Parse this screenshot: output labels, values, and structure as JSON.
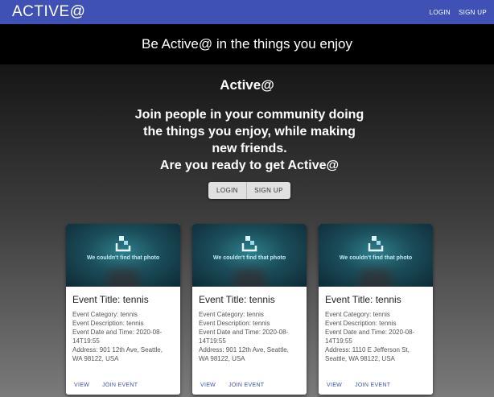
{
  "appbar": {
    "brand": "ACTIVE@",
    "login_label": "LOGIN",
    "signup_label": "SIGN UP",
    "color": "#3f51b5"
  },
  "banner": {
    "text": "Be Active@ in the things you enjoy"
  },
  "hero": {
    "title": "Active@",
    "lines": [
      "Join people in your community doing",
      "the things you enjoy, while making",
      "new friends.",
      "Are you ready to get Active@"
    ],
    "login_label": "LOGIN",
    "signup_label": "SIGN UP"
  },
  "cards": [
    {
      "image_text": "We couldn't find that photo",
      "title": "Event Title: tennis",
      "category": "Event Category: tennis",
      "description": "Event Description: tennis",
      "datetime_a": "Event Date and Time: 2020-08-",
      "datetime_b": "14T19:55",
      "address_a": "Address: 901 12th Ave, Seattle,",
      "address_b": "WA 98122, USA",
      "view_label": "VIEW",
      "join_label": "JOIN EVENT"
    },
    {
      "image_text": "We couldn't find that photo",
      "title": "Event Title: tennis",
      "category": "Event Category: tennis",
      "description": "Event Description: tennis",
      "datetime_a": "Event Date and Time: 2020-08-",
      "datetime_b": "14T19:55",
      "address_a": "Address: 901 12th Ave, Seattle,",
      "address_b": "WA 98122, USA",
      "view_label": "VIEW",
      "join_label": "JOIN EVENT"
    },
    {
      "image_text": "We couldn't find that photo",
      "title": "Event Title: tennis",
      "category": "Event Category: tennis",
      "description": "Event Description: tennis",
      "datetime_a": "Event Date and Time: 2020-08-",
      "datetime_b": "14T19:55",
      "address_a": "Address: 1110 E Jefferson St,",
      "address_b": "Seattle, WA 98122, USA",
      "view_label": "VIEW",
      "join_label": "JOIN EVENT"
    }
  ]
}
